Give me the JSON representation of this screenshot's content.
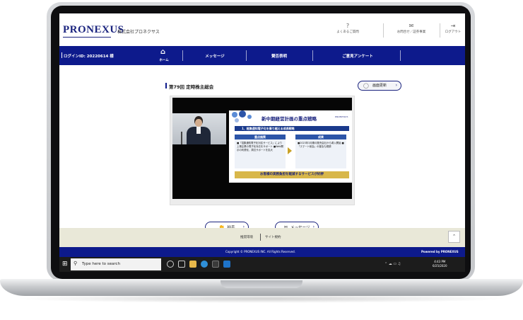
{
  "header": {
    "logo": "PRONEXUS",
    "company": "株式会社プロネクサス",
    "faq_label": "よくあるご質問",
    "contact_label": "お問合せ／証券事業",
    "logout_label": "ログアウト"
  },
  "nav": {
    "login_id": "ログインID: 20220614 様",
    "home": "ホーム",
    "message": "メッセージ",
    "vote": "賛否表明",
    "survey": "ご意見アンケート"
  },
  "main": {
    "title": "第79回 定時株主総会",
    "refresh_label": "画面更新",
    "applause_label": "拍手",
    "message_label": "メッセージ"
  },
  "slide": {
    "title": "新中期経営計画の重点戦略",
    "brand": "PRONEXUS",
    "section": "1、総集通知電子化を乗り越える成長戦略",
    "col1_head": "重点施策",
    "col1_text": "■「招集通知電子化対応サービス」により上場企業の電子化対応をサポート ■Web開示の利便化、周辺サポートを拡大",
    "col2_head": "成果",
    "col2_text": "■2023年3月期の販売会社から導入開始 ■「スマート総会」の普及も順調",
    "banner": "お客様の実務負担を軽減するサービスが好評"
  },
  "footer": {
    "link1": "推奨環境",
    "link2": "サイト規約",
    "copyright": "Copyright © PRONEXUS INC. All Rights Reserved.",
    "powered": "Powered by PRONEXUS"
  },
  "taskbar": {
    "search_placeholder": "Type here to search",
    "time": "4:43 PM",
    "date": "6/25/2020"
  },
  "colors": {
    "brand_navy": "#0d1a8c",
    "footer_beige": "#e9e8d8",
    "gold": "#d8b74a"
  }
}
